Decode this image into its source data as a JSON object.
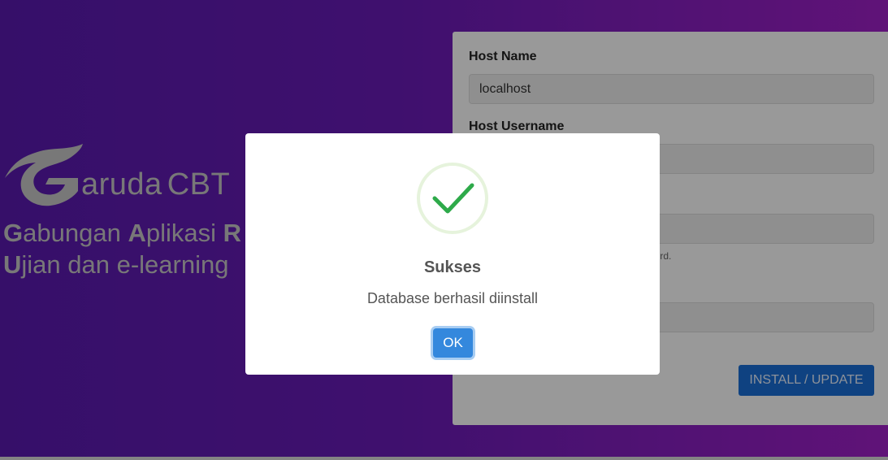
{
  "brand": {
    "logo_letter": "G",
    "logo_name": "aruda",
    "logo_suffix": "CBT",
    "tagline_line1_parts": [
      "G",
      "abungan ",
      "A",
      "plikasi ",
      "R"
    ],
    "tagline_line2_parts": [
      "U",
      "jian dan e-learning"
    ]
  },
  "form": {
    "host_name_label": "Host Name",
    "host_name_value": "localhost",
    "host_username_label": "Host Username",
    "password_hint": "word.",
    "install_button": "INSTALL / UPDATE"
  },
  "modal": {
    "icon": "check-icon",
    "title": "Sukses",
    "message": "Database berhasil diinstall",
    "ok_button": "OK"
  },
  "colors": {
    "background_start": "#5a1ab0",
    "background_end": "#a020c8",
    "primary_button": "#1a6fd8",
    "ok_button": "#3488dd",
    "success_check": "#2eaa4a"
  }
}
